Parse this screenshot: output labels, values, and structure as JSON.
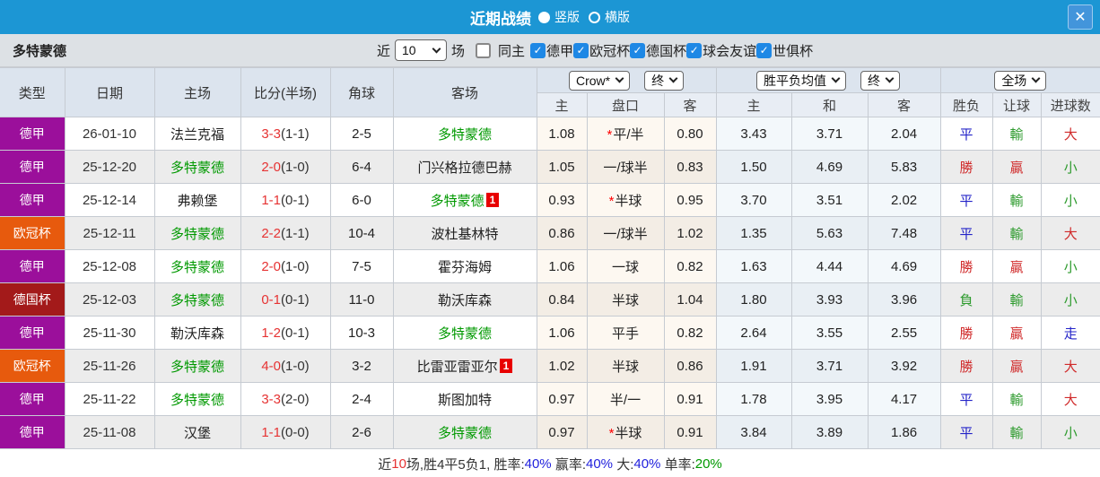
{
  "titlebar": {
    "title": "近期战绩",
    "layout_options": [
      {
        "label": "竖版",
        "selected": true
      },
      {
        "label": "横版",
        "selected": false
      }
    ],
    "close_label": "✕"
  },
  "filterbar": {
    "team": "多特蒙德",
    "recent_prefix": "近",
    "recent_value": "10",
    "recent_suffix": "场",
    "checkboxes": [
      {
        "label": "同主",
        "checked": false
      },
      {
        "label": "德甲",
        "checked": true
      },
      {
        "label": "欧冠杯",
        "checked": true
      },
      {
        "label": "德国杯",
        "checked": true
      },
      {
        "label": "球会友谊",
        "checked": true
      },
      {
        "label": "世俱杯",
        "checked": true
      }
    ]
  },
  "table": {
    "static_headers": [
      "类型",
      "日期",
      "主场",
      "比分(半场)",
      "角球",
      "客场"
    ],
    "group_dropdowns": {
      "handicap_source": "Crow*",
      "handicap_time": "终",
      "odds_source": "胜平负均值",
      "odds_time": "终",
      "result_scope": "全场"
    },
    "sub_headers": [
      "主",
      "盘口",
      "客",
      "主",
      "和",
      "客",
      "胜负",
      "让球",
      "进球数"
    ],
    "colors": {
      "blue": "#2323C8",
      "green": "#2E9B2E",
      "red": "#D02A2A",
      "league_dejia": "#9B0F9B",
      "league_ouguan": "#E75A0D",
      "league_deguobei": "#A31A1A"
    },
    "rows": [
      {
        "league": "德甲",
        "league_color": "#9B0F9B",
        "date": "26-01-10",
        "home": "法兰克福",
        "home_green": false,
        "home_badge": "",
        "score": "3-3",
        "half": "(1-1)",
        "corners": "2-5",
        "away": "多特蒙德",
        "away_green": true,
        "away_badge": "",
        "ah_star": true,
        "ah_home": "1.08",
        "ah_line": "平/半",
        "ah_away": "0.80",
        "odds_home": "3.43",
        "odds_draw": "3.71",
        "odds_away": "2.04",
        "result": "平",
        "result_color": "#2323C8",
        "handicap_result": "輸",
        "handicap_color": "#2E9B2E",
        "goals": "大",
        "goals_color": "#D02A2A"
      },
      {
        "league": "德甲",
        "league_color": "#9B0F9B",
        "date": "25-12-20",
        "home": "多特蒙德",
        "home_green": true,
        "home_badge": "",
        "score": "2-0",
        "half": "(1-0)",
        "corners": "6-4",
        "away": "门兴格拉德巴赫",
        "away_green": false,
        "away_badge": "",
        "ah_star": false,
        "ah_home": "1.05",
        "ah_line": "一/球半",
        "ah_away": "0.83",
        "odds_home": "1.50",
        "odds_draw": "4.69",
        "odds_away": "5.83",
        "result": "勝",
        "result_color": "#D02A2A",
        "handicap_result": "贏",
        "handicap_color": "#D02A2A",
        "goals": "小",
        "goals_color": "#2E9B2E"
      },
      {
        "league": "德甲",
        "league_color": "#9B0F9B",
        "date": "25-12-14",
        "home": "弗赖堡",
        "home_green": false,
        "home_badge": "",
        "score": "1-1",
        "half": "(0-1)",
        "corners": "6-0",
        "away": "多特蒙德",
        "away_green": true,
        "away_badge": "1",
        "ah_star": true,
        "ah_home": "0.93",
        "ah_line": "半球",
        "ah_away": "0.95",
        "odds_home": "3.70",
        "odds_draw": "3.51",
        "odds_away": "2.02",
        "result": "平",
        "result_color": "#2323C8",
        "handicap_result": "輸",
        "handicap_color": "#2E9B2E",
        "goals": "小",
        "goals_color": "#2E9B2E"
      },
      {
        "league": "欧冠杯",
        "league_color": "#E75A0D",
        "date": "25-12-11",
        "home": "多特蒙德",
        "home_green": true,
        "home_badge": "",
        "score": "2-2",
        "half": "(1-1)",
        "corners": "10-4",
        "away": "波杜基林特",
        "away_green": false,
        "away_badge": "",
        "ah_star": false,
        "ah_home": "0.86",
        "ah_line": "一/球半",
        "ah_away": "1.02",
        "odds_home": "1.35",
        "odds_draw": "5.63",
        "odds_away": "7.48",
        "result": "平",
        "result_color": "#2323C8",
        "handicap_result": "輸",
        "handicap_color": "#2E9B2E",
        "goals": "大",
        "goals_color": "#D02A2A"
      },
      {
        "league": "德甲",
        "league_color": "#9B0F9B",
        "date": "25-12-08",
        "home": "多特蒙德",
        "home_green": true,
        "home_badge": "",
        "score": "2-0",
        "half": "(1-0)",
        "corners": "7-5",
        "away": "霍芬海姆",
        "away_green": false,
        "away_badge": "",
        "ah_star": false,
        "ah_home": "1.06",
        "ah_line": "一球",
        "ah_away": "0.82",
        "odds_home": "1.63",
        "odds_draw": "4.44",
        "odds_away": "4.69",
        "result": "勝",
        "result_color": "#D02A2A",
        "handicap_result": "贏",
        "handicap_color": "#D02A2A",
        "goals": "小",
        "goals_color": "#2E9B2E"
      },
      {
        "league": "德国杯",
        "league_color": "#A31A1A",
        "date": "25-12-03",
        "home": "多特蒙德",
        "home_green": true,
        "home_badge": "",
        "score": "0-1",
        "half": "(0-1)",
        "corners": "11-0",
        "away": "勒沃库森",
        "away_green": false,
        "away_badge": "",
        "ah_star": false,
        "ah_home": "0.84",
        "ah_line": "半球",
        "ah_away": "1.04",
        "odds_home": "1.80",
        "odds_draw": "3.93",
        "odds_away": "3.96",
        "result": "負",
        "result_color": "#2E9B2E",
        "handicap_result": "輸",
        "handicap_color": "#2E9B2E",
        "goals": "小",
        "goals_color": "#2E9B2E"
      },
      {
        "league": "德甲",
        "league_color": "#9B0F9B",
        "date": "25-11-30",
        "home": "勒沃库森",
        "home_green": false,
        "home_badge": "",
        "score": "1-2",
        "half": "(0-1)",
        "corners": "10-3",
        "away": "多特蒙德",
        "away_green": true,
        "away_badge": "",
        "ah_star": false,
        "ah_home": "1.06",
        "ah_line": "平手",
        "ah_away": "0.82",
        "odds_home": "2.64",
        "odds_draw": "3.55",
        "odds_away": "2.55",
        "result": "勝",
        "result_color": "#D02A2A",
        "handicap_result": "贏",
        "handicap_color": "#D02A2A",
        "goals": "走",
        "goals_color": "#2323C8"
      },
      {
        "league": "欧冠杯",
        "league_color": "#E75A0D",
        "date": "25-11-26",
        "home": "多特蒙德",
        "home_green": true,
        "home_badge": "",
        "score": "4-0",
        "half": "(1-0)",
        "corners": "3-2",
        "away": "比雷亚雷亚尔",
        "away_green": false,
        "away_badge": "1",
        "ah_star": false,
        "ah_home": "1.02",
        "ah_line": "半球",
        "ah_away": "0.86",
        "odds_home": "1.91",
        "odds_draw": "3.71",
        "odds_away": "3.92",
        "result": "勝",
        "result_color": "#D02A2A",
        "handicap_result": "贏",
        "handicap_color": "#D02A2A",
        "goals": "大",
        "goals_color": "#D02A2A"
      },
      {
        "league": "德甲",
        "league_color": "#9B0F9B",
        "date": "25-11-22",
        "home": "多特蒙德",
        "home_green": true,
        "home_badge": "",
        "score": "3-3",
        "half": "(2-0)",
        "corners": "2-4",
        "away": "斯图加特",
        "away_green": false,
        "away_badge": "",
        "ah_star": false,
        "ah_home": "0.97",
        "ah_line": "半/一",
        "ah_away": "0.91",
        "odds_home": "1.78",
        "odds_draw": "3.95",
        "odds_away": "4.17",
        "result": "平",
        "result_color": "#2323C8",
        "handicap_result": "輸",
        "handicap_color": "#2E9B2E",
        "goals": "大",
        "goals_color": "#D02A2A"
      },
      {
        "league": "德甲",
        "league_color": "#9B0F9B",
        "date": "25-11-08",
        "home": "汉堡",
        "home_green": false,
        "home_badge": "",
        "score": "1-1",
        "half": "(0-0)",
        "corners": "2-6",
        "away": "多特蒙德",
        "away_green": true,
        "away_badge": "",
        "ah_star": true,
        "ah_home": "0.97",
        "ah_line": "半球",
        "ah_away": "0.91",
        "odds_home": "3.84",
        "odds_draw": "3.89",
        "odds_away": "1.86",
        "result": "平",
        "result_color": "#2323C8",
        "handicap_result": "輸",
        "handicap_color": "#2E9B2E",
        "goals": "小",
        "goals_color": "#2E9B2E"
      }
    ]
  },
  "summary": {
    "segments": [
      {
        "text": "近",
        "color": "#333333"
      },
      {
        "text": "10",
        "color": "#E63333"
      },
      {
        "text": "场,胜4平5负1, 胜率:",
        "color": "#333333"
      },
      {
        "text": "40%",
        "color": "#2222DD"
      },
      {
        "text": " 赢率:",
        "color": "#333333"
      },
      {
        "text": "40%",
        "color": "#2222DD"
      },
      {
        "text": " 大:",
        "color": "#333333"
      },
      {
        "text": "40%",
        "color": "#2222DD"
      },
      {
        "text": " 单率:",
        "color": "#333333"
      },
      {
        "text": "20%",
        "color": "#009900"
      }
    ]
  }
}
